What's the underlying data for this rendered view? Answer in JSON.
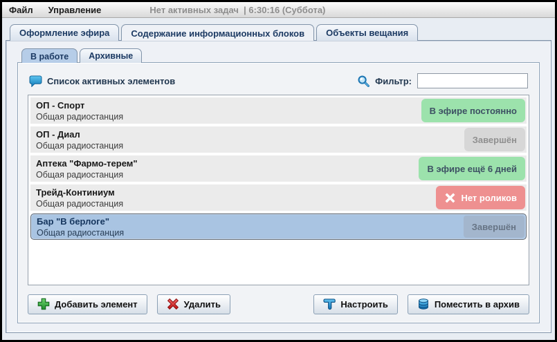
{
  "menu_bar": {
    "items": [
      "Файл",
      "Управление"
    ],
    "status": "Нет активных задач  | 6:30:16 (Суббота)"
  },
  "main_tabs": [
    {
      "label": "Оформление эфира",
      "active": false
    },
    {
      "label": "Содержание информационных блоков",
      "active": true
    },
    {
      "label": "Объекты вещания",
      "active": false
    }
  ],
  "inner_tabs": [
    {
      "label": "В работе",
      "active": true
    },
    {
      "label": "Архивные",
      "active": false
    }
  ],
  "content": {
    "header_title": "Список активных элементов",
    "filter_label": "Фильтр:",
    "filter_value": ""
  },
  "list": {
    "items": [
      {
        "title": "ОП - Спорт",
        "subtitle": "Общая радиостанция",
        "status": "В эфире постоянно",
        "status_type": "green",
        "selected": false
      },
      {
        "title": "ОП - Диал",
        "subtitle": "Общая радиостанция",
        "status": "Завершён",
        "status_type": "gray",
        "selected": false
      },
      {
        "title": "Аптека \"Фармо-терем\"",
        "subtitle": "Общая радиостанция",
        "status": "В эфире ещё 6 дней",
        "status_type": "green",
        "selected": false
      },
      {
        "title": "Трейд-Континиум",
        "subtitle": "Общая радиостанция",
        "status": "Нет роликов",
        "status_type": "red",
        "selected": false
      },
      {
        "title": "Бар \"В берлоге\"",
        "subtitle": "Общая радиостанция",
        "status": "Завершён",
        "status_type": "gray",
        "selected": true
      }
    ]
  },
  "buttons": {
    "add": "Добавить элемент",
    "delete": "Удалить",
    "configure": "Настроить",
    "archive": "Поместить в архив"
  },
  "icons": {
    "header": "speech-bubble-icon",
    "filter": "magnifier-icon",
    "add": "green-plus-icon",
    "delete": "red-cross-icon",
    "no_clips": "white-cross-icon",
    "configure": "hammer-icon",
    "archive": "database-icon"
  },
  "colors": {
    "status_on_air_bg": "#9ce2ac",
    "status_finished_bg": "#d7d7d7",
    "status_error_bg": "#ee9090",
    "selection_bg": "#a9c4e2",
    "tab_text": "#1c3a63",
    "panel_bg": "#eef1f6"
  }
}
